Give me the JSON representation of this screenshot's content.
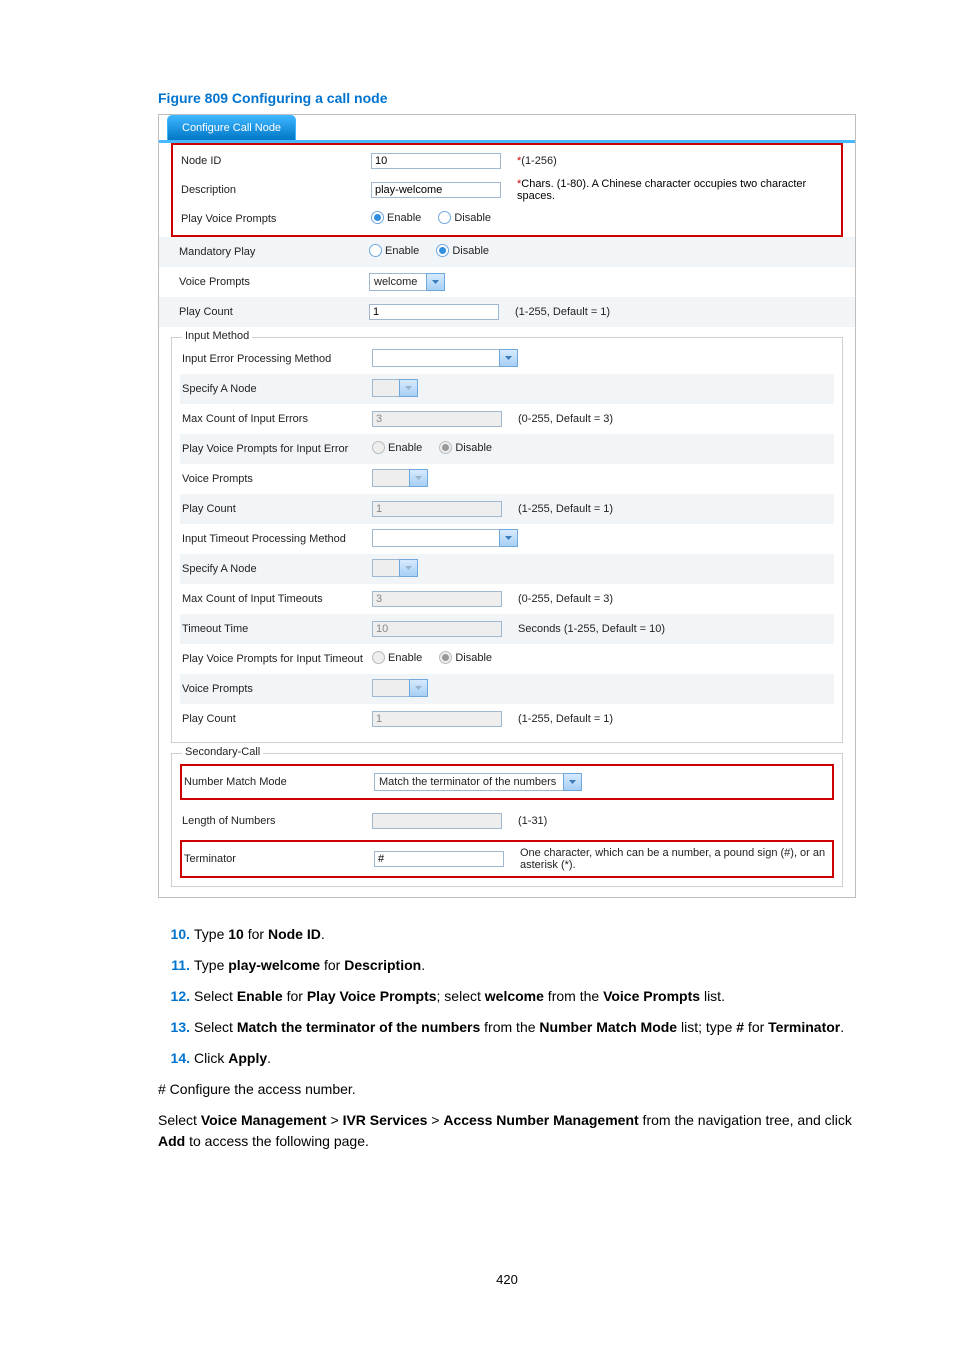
{
  "figure_title": "Figure 809 Configuring a call node",
  "tab": "Configure Call Node",
  "fields": {
    "node_id": {
      "label": "Node ID",
      "value": "10",
      "hint_star": "*",
      "hint": "(1-256)"
    },
    "description": {
      "label": "Description",
      "value": "play-welcome",
      "hint_star": "*",
      "hint": "Chars. (1-80). A Chinese character occupies two character spaces."
    },
    "play_voice": {
      "label": "Play Voice Prompts",
      "enable": "Enable",
      "disable": "Disable"
    },
    "mandatory_play": {
      "label": "Mandatory Play",
      "enable": "Enable",
      "disable": "Disable"
    },
    "voice_prompts": {
      "label": "Voice Prompts",
      "value": "welcome"
    },
    "play_count": {
      "label": "Play Count",
      "value": "1",
      "hint": "(1-255, Default = 1)"
    }
  },
  "input_method": {
    "legend": "Input Method",
    "error_method": {
      "label": "Input Error Processing Method",
      "value": ""
    },
    "specify_node_e": {
      "label": "Specify A Node",
      "value": ""
    },
    "max_errors": {
      "label": "Max Count of Input Errors",
      "value": "3",
      "hint": "(0-255, Default = 3)"
    },
    "pvp_error": {
      "label": "Play Voice Prompts for Input Error",
      "enable": "Enable",
      "disable": "Disable"
    },
    "vp_error": {
      "label": "Voice Prompts",
      "value": ""
    },
    "pc_error": {
      "label": "Play Count",
      "value": "1",
      "hint": "(1-255, Default = 1)"
    },
    "timeout_method": {
      "label": "Input Timeout Processing Method",
      "value": ""
    },
    "specify_node_t": {
      "label": "Specify A Node",
      "value": ""
    },
    "max_timeouts": {
      "label": "Max Count of Input Timeouts",
      "value": "3",
      "hint": "(0-255, Default = 3)"
    },
    "timeout_time": {
      "label": "Timeout Time",
      "value": "10",
      "hint": "Seconds (1-255, Default = 10)"
    },
    "pvp_timeout": {
      "label": "Play Voice Prompts for Input Timeout",
      "enable": "Enable",
      "disable": "Disable"
    },
    "vp_timeout": {
      "label": "Voice Prompts",
      "value": ""
    },
    "pc_timeout": {
      "label": "Play Count",
      "value": "1",
      "hint": "(1-255, Default = 1)"
    }
  },
  "secondary": {
    "legend": "Secondary-Call",
    "match_mode": {
      "label": "Number Match Mode",
      "value": "Match the terminator of the numbers"
    },
    "length": {
      "label": "Length of Numbers",
      "value": "",
      "hint": "(1-31)"
    },
    "terminator": {
      "label": "Terminator",
      "value": "#",
      "hint": "One character, which can be a number, a pound sign (#), or an asterisk (*)."
    }
  },
  "steps": [
    {
      "n": "10.",
      "pre": "Type ",
      "b1": "10",
      "mid": " for ",
      "b2": "Node ID",
      "post": "."
    },
    {
      "n": "11.",
      "pre": "Type ",
      "b1": "play-welcome",
      "mid": " for ",
      "b2": "Description",
      "post": "."
    },
    {
      "n": "12.",
      "pre": "Select ",
      "b1": "Enable",
      "mid": " for ",
      "b2": "Play Voice Prompts",
      "post": "; select ",
      "b3": "welcome",
      "mid2": " from the ",
      "b4": "Voice Prompts",
      "post2": " list."
    },
    {
      "n": "13.",
      "pre": "Select ",
      "b1": "Match the terminator of the numbers",
      "mid": " from the ",
      "b2": "Number Match Mode",
      "post": " list; type ",
      "b3": "#",
      "mid2": " for ",
      "b4": "Terminator",
      "post2": "."
    },
    {
      "n": "14.",
      "pre": "Click ",
      "b1": "Apply",
      "post": "."
    }
  ],
  "after1": "# Configure the access number.",
  "after2": {
    "pre": "Select ",
    "b1": "Voice Management",
    "sep": " > ",
    "b2": "IVR Services",
    "b3": "Access Number Management",
    "mid": " from the navigation tree, and click ",
    "b4": "Add",
    "post": " to access the following page."
  },
  "pagenum": "420"
}
